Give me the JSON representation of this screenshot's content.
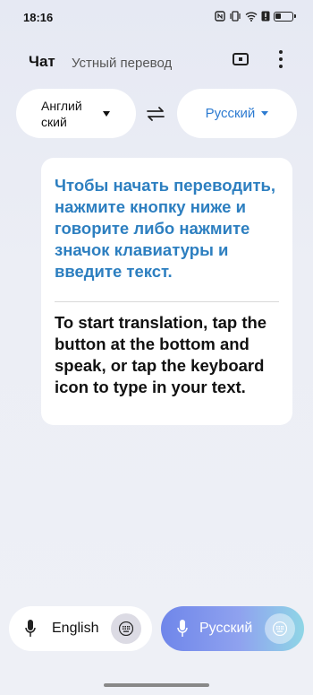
{
  "status_bar": {
    "time": "18:16",
    "icons": [
      "nfc-icon",
      "vibrate-icon",
      "wifi-icon",
      "alert-icon",
      "battery-icon"
    ]
  },
  "header": {
    "tab_chat": "Чат",
    "tab_voice": "Устный перевод",
    "icons": [
      "screen-mode-icon",
      "more-vertical-icon"
    ]
  },
  "languages": {
    "source": "Англий ский",
    "target": "Русский",
    "swap_icon": "swap-arrows-icon"
  },
  "card": {
    "ru_text": "Чтобы начать переводить, нажмите кнопку ниже и говорите либо нажмите значок клавиатуры и введите текст.",
    "en_text": "To start translation, tap the button at the bottom and speak, or tap the keyboard icon to type in your text."
  },
  "bottom": {
    "left_label": "English",
    "right_label": "Русский",
    "accent_from": "#6f86ea",
    "accent_to": "#8fd6e6"
  },
  "colors": {
    "accent_blue": "#2d7bd1",
    "card_ru_text": "#2d7fc0"
  }
}
